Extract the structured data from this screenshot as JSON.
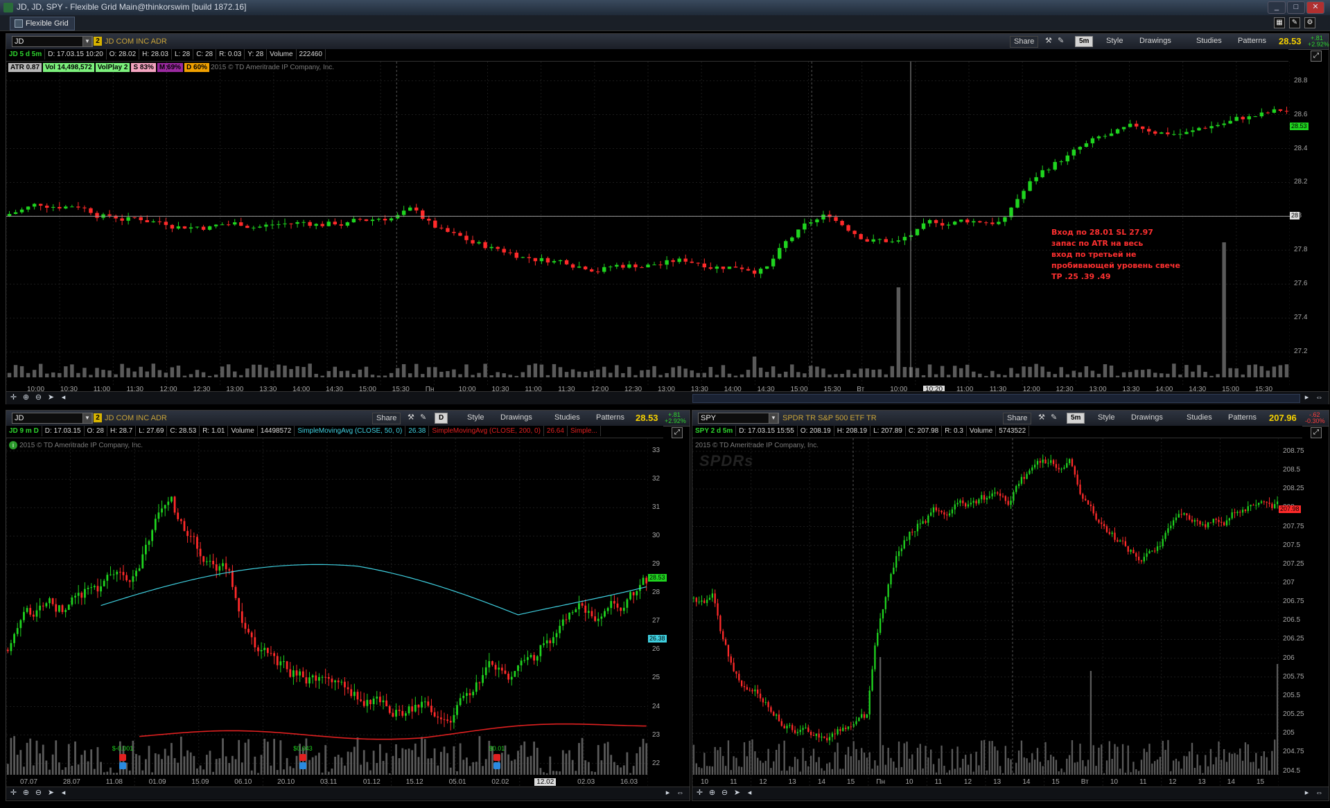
{
  "window": {
    "title": "JD, JD, SPY - Flexible Grid Main@thinkorswim [build 1872.16]",
    "buttons": [
      "_",
      "□",
      "✕"
    ]
  },
  "grid_tab": {
    "label": "Flexible Grid"
  },
  "top_chart": {
    "symbol": "JD",
    "description": "JD COM INC ADR",
    "badge": "2",
    "share_label": "Share",
    "period": "5m",
    "style_label": "Style",
    "drawings_label": "Drawings",
    "studies_label": "Studies",
    "patterns_label": "Patterns",
    "last_price": "28.53",
    "change_abs": "+.81",
    "change_pct": "+2.92%",
    "info": {
      "label": "JD 5 d 5m",
      "date": "D: 17.03.15 10:20",
      "open": "O: 28.02",
      "high": "H: 28.03",
      "low": "L: 28",
      "close": "C: 28",
      "range": "R: 0.03",
      "y": "Y: 28",
      "volume_label": "Volume",
      "volume": "222460"
    },
    "chips": [
      {
        "text": "ATR 0.87",
        "bg": "#b7b7b7",
        "fg": "#000"
      },
      {
        "text": "Vol 14,498,572",
        "bg": "#7cf07c",
        "fg": "#000"
      },
      {
        "text": "VolPlay 2",
        "bg": "#7cf07c",
        "fg": "#000"
      },
      {
        "text": "S 83%",
        "bg": "#f4a4c0",
        "fg": "#000"
      },
      {
        "text": "M 69%",
        "bg": "#9b2aa0",
        "fg": "#000"
      },
      {
        "text": "D 60%",
        "bg": "#f0a000",
        "fg": "#000"
      }
    ],
    "copyright": "2015 © TD Ameritrade IP Company, Inc.",
    "y_ticks": [
      "28.8",
      "28.6",
      "28.4",
      "28.2",
      "28",
      "27.8",
      "27.6",
      "27.4",
      "27.2"
    ],
    "x_ticks": [
      "10:00",
      "10:30",
      "11:00",
      "11:30",
      "12:00",
      "12:30",
      "13:00",
      "13:30",
      "14:00",
      "14:30",
      "15:00",
      "15:30",
      "Пн",
      "10:00",
      "10:30",
      "11:00",
      "11:30",
      "12:00",
      "12:30",
      "13:00",
      "13:30",
      "14:00",
      "14:30",
      "15:00",
      "15:30",
      "Вт",
      "10:00",
      "10:20",
      "11:00",
      "11:30",
      "12:00",
      "12:30",
      "13:00",
      "13:30",
      "14:00",
      "14:30",
      "15:00",
      "15:30"
    ],
    "price_tag": "28.53",
    "cursor_tag": "28",
    "cursor_time": "10:20",
    "annotation": [
      "Вход по 28.01 SL 27.97",
      "запас по ATR на весь",
      "вход по третьей не",
      "пробивающей уровень свече",
      "TP .25 .39 .49"
    ]
  },
  "bottom_left_chart": {
    "symbol": "JD",
    "description": "JD COM INC ADR",
    "badge": "2",
    "share_label": "Share",
    "period": "D",
    "style_label": "Style",
    "drawings_label": "Drawings",
    "studies_label": "Studies",
    "patterns_label": "Patterns",
    "last_price": "28.53",
    "change_abs": "+.81",
    "change_pct": "+2.92%",
    "info": {
      "label": "JD 9 m D",
      "date": "D: 17.03.15",
      "open": "O: 28",
      "high": "H: 28.7",
      "low": "L: 27.69",
      "close": "C: 28.53",
      "range": "R: 1.01",
      "volume_label": "Volume",
      "volume": "14498572",
      "sma50_label": "SimpleMovingAvg (CLOSE, 50, 0)",
      "sma50": "26.38",
      "sma200_label": "SimpleMovingAvg (CLOSE, 200, 0)",
      "sma200": "26.64",
      "more": "Simple..."
    },
    "copyright": "2015 © TD Ameritrade IP Company, Inc.",
    "y_ticks": [
      "33",
      "32",
      "31",
      "30",
      "29",
      "28",
      "27",
      "26",
      "25",
      "24",
      "23",
      "22"
    ],
    "x_ticks": [
      "07.07",
      "28.07",
      "11.08",
      "01.09",
      "15.09",
      "06.10",
      "20.10",
      "03.11",
      "01.12",
      "15.12",
      "05.01",
      "02.02",
      "12.02",
      "02.03",
      "16.03"
    ],
    "tags": {
      "price": "28.53",
      "sma": "26.38"
    },
    "events": [
      "$-0.001",
      "$0.043",
      "$0.01"
    ]
  },
  "bottom_right_chart": {
    "symbol": "SPY",
    "description": "SPDR TR S&P 500 ETF TR",
    "share_label": "Share",
    "period": "5m",
    "style_label": "Style",
    "drawings_label": "Drawings",
    "studies_label": "Studies",
    "patterns_label": "Patterns",
    "last_price": "207.96",
    "change_abs": "-.62",
    "change_pct": "-0.30%",
    "info": {
      "label": "SPY 2 d 5m",
      "date": "D: 17.03.15 15:55",
      "open": "O: 208.19",
      "high": "H: 208.19",
      "low": "L: 207.89",
      "close": "C: 207.98",
      "range": "R: 0.3",
      "volume_label": "Volume",
      "volume": "5743522"
    },
    "copyright": "2015 © TD Ameritrade IP Company, Inc.",
    "watermark": "SPDRs",
    "y_ticks": [
      "208.75",
      "208.5",
      "208.25",
      "208",
      "207.75",
      "207.5",
      "207.25",
      "207",
      "206.75",
      "206.5",
      "206.25",
      "206",
      "205.75",
      "205.5",
      "205.25",
      "205",
      "204.75",
      "204.5"
    ],
    "x_ticks": [
      "10",
      "11",
      "12",
      "13",
      "14",
      "15",
      "Пн",
      "10",
      "11",
      "12",
      "13",
      "14",
      "15",
      "Вт",
      "10",
      "11",
      "12",
      "13",
      "14",
      "15"
    ],
    "price_tag": "207.98"
  },
  "colors": {
    "up": "#1fd41f",
    "down": "#ff2a2a",
    "volume": "#5a5a5a",
    "sma50": "#3fd0e0",
    "sma200": "#e02020"
  }
}
